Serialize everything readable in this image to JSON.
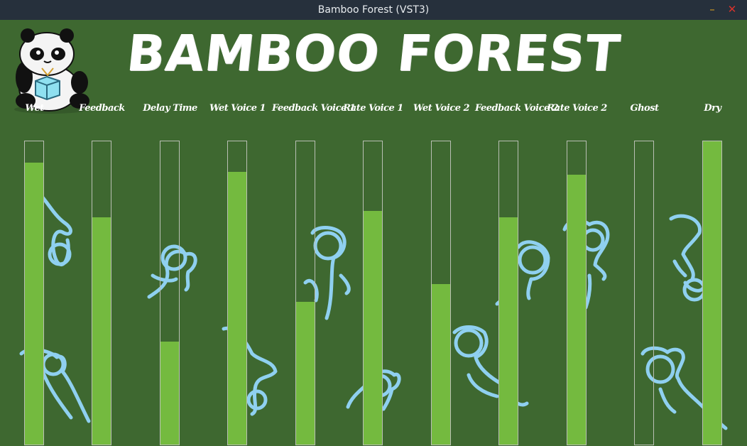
{
  "window": {
    "title": "Bamboo Forest (VST3)",
    "minimize_glyph": "–",
    "close_glyph": "✕",
    "colors": {
      "titlebar": "#26303c",
      "minimize": "#d8a020",
      "close": "#d8322c"
    }
  },
  "plugin": {
    "logo_text": "BAMBOO FOREST",
    "colors": {
      "background": "#3e6830",
      "fill": "#74ba3f",
      "outline": "#b9bfb4",
      "critter": "#8fd0f0"
    }
  },
  "sliders": [
    {
      "label": "Wet",
      "value": 0.93
    },
    {
      "label": "Feedback",
      "value": 0.75
    },
    {
      "label": "Delay Time",
      "value": 0.34
    },
    {
      "label": "Wet Voice 1",
      "value": 0.9
    },
    {
      "label": "Feedback Voice 1",
      "value": 0.47
    },
    {
      "label": "Rate Voice 1",
      "value": 0.77
    },
    {
      "label": "Wet Voice 2",
      "value": 0.53
    },
    {
      "label": "Feedback Voice 2",
      "value": 0.75
    },
    {
      "label": "Rate Voice 2",
      "value": 0.89
    },
    {
      "label": "Ghost",
      "value": 0.0
    },
    {
      "label": "Dry",
      "value": 1.0
    }
  ]
}
